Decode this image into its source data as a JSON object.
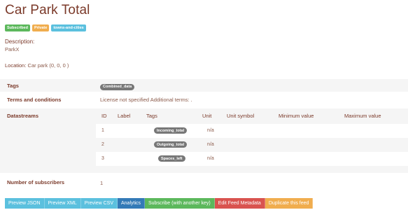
{
  "page": {
    "title": "Car Park Total",
    "badges": [
      "Subscribed",
      "Private",
      "towns-and-cities"
    ],
    "description_label": "Description:",
    "description_value": "ParkX",
    "location_label": "Location:",
    "location_value": "Car park (0, 0, 0 )"
  },
  "rows": {
    "tags_label": "Tags",
    "tags_value": "Combined_data",
    "terms_label": "Terms and conditions",
    "terms_value": "License not specified Additional terms: .",
    "datastreams_label": "Datastreams",
    "subscribers_label": "Number of subscribers",
    "subscribers_value": "1"
  },
  "datastreams": {
    "headers": [
      "ID",
      "Label",
      "Tags",
      "Unit",
      "Unit symbol",
      "Minimum value",
      "Maximum value"
    ],
    "rows": [
      {
        "id": "1",
        "label": "",
        "tag": "Incoming_total",
        "unit": "n/a"
      },
      {
        "id": "2",
        "label": "",
        "tag": "Outgoing_total",
        "unit": "n/a"
      },
      {
        "id": "3",
        "label": "",
        "tag": "Spaces_left",
        "unit": "n/a"
      }
    ]
  },
  "buttons": {
    "preview_json": "Preview JSON",
    "preview_xml": "Preview XML",
    "preview_csv": "Preview CSV",
    "analytics": "Analytics",
    "subscribe": "Subscribe (with another key)",
    "edit": "Edit Feed Metadata",
    "duplicate": "Duplicate this feed"
  },
  "colors": {
    "success": "#5cb85c",
    "warning": "#f0ad4e",
    "info": "#5bc0de",
    "primary": "#337ab7",
    "danger": "#d9534f",
    "text": "#7b3a2a"
  }
}
